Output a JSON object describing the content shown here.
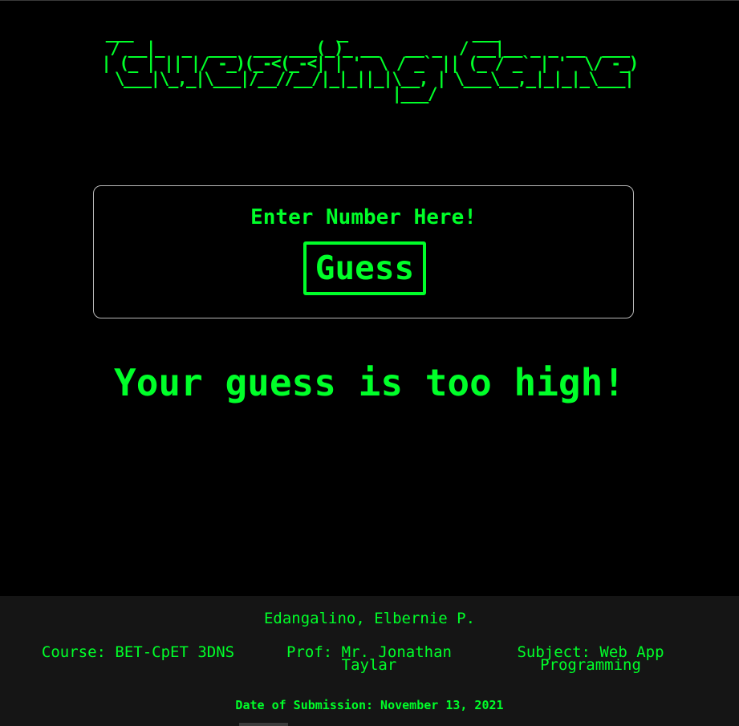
{
  "header": {
    "title": "Guessing Game",
    "ascii_art": "  ___                       _              ___                 \n / __|_  _  ___  ___ ___(_)_ __   __ _  / __|__ _ _ __  ___ \n| (_ | || |/ -_)(_-<(_-<| | '  \\ / _` || (_ / _` | '  \\/ -_)\n \\___|\\_,_|\\___|/__//__/|_|_||_|\\__, | \\___\\__,_|_|_|_\\___|\n                                |___/                      "
  },
  "game": {
    "prompt_label": "Enter Number Here!",
    "guess_button_label": "Guess",
    "result_message": "Your guess is too high!"
  },
  "footer": {
    "author": "Edangalino, Elbernie P.",
    "course": "Course: BET-CpET 3DNS",
    "prof": "Prof: Mr. Jonathan Taylar",
    "subject": "Subject: Web App Programming",
    "submission": "Date of Submission: November 13, 2021"
  },
  "colors": {
    "accent": "#00ff29",
    "background": "#000000",
    "footer_background": "#151515",
    "panel_border": "#b8b8b8"
  }
}
